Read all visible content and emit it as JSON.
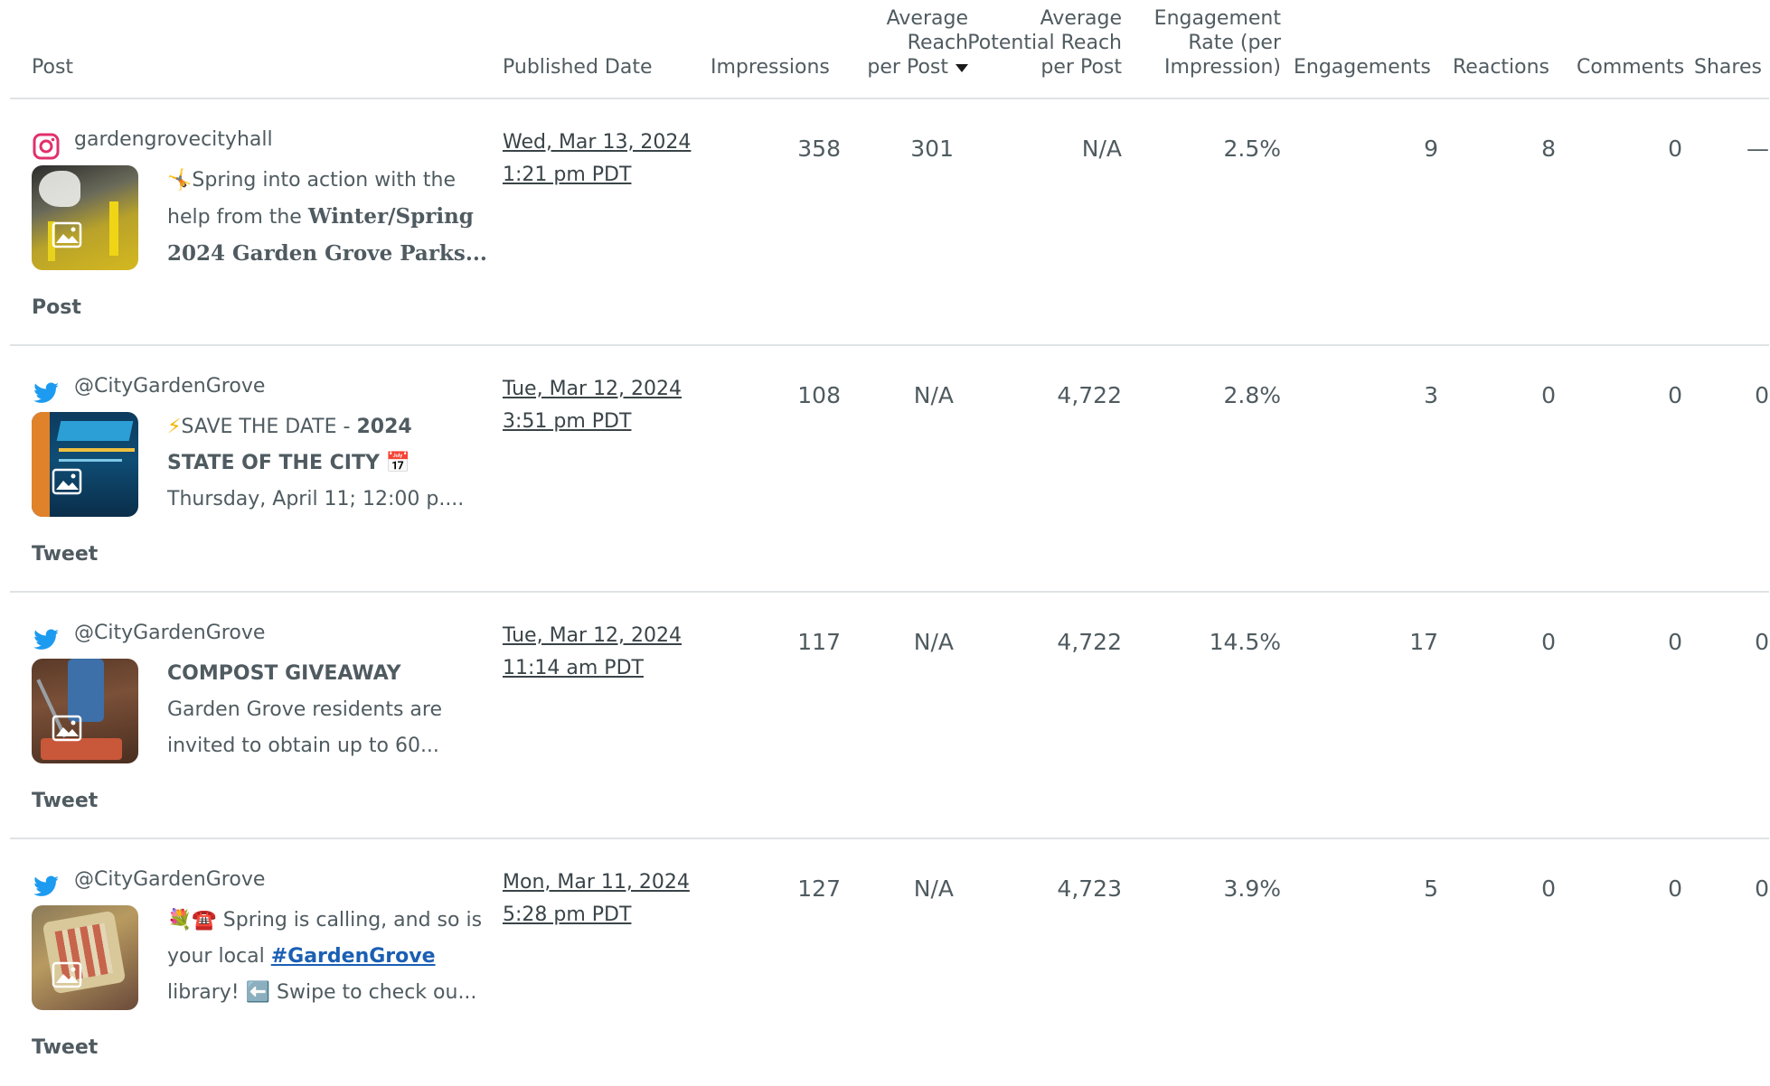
{
  "columns": {
    "post": "Post",
    "published_date": "Published Date",
    "impressions": "Impressions",
    "avg_reach_l1": "Average",
    "avg_reach_l2": "Reach",
    "avg_reach_l3": "per Post",
    "avg_pot_l1": "Average",
    "avg_pot_l2": "Potential Reach",
    "avg_pot_l3": "per Post",
    "eng_rate_l1": "Engagement",
    "eng_rate_l2": "Rate (per",
    "eng_rate_l3": "Impression)",
    "engagements": "Engagements",
    "reactions": "Reactions",
    "comments": "Comments",
    "shares": "Shares"
  },
  "rows": [
    {
      "network": "instagram-icon",
      "handle": "gardengrovecityhall",
      "text": {
        "l1_emoji": "🤸",
        "l1": "Spring into action with the",
        "l2": "help from the ",
        "l2_bold": "Winter/Spring",
        "l3_bold": "2024 Garden Grove Parks..."
      },
      "type": "Post",
      "date": "Wed, Mar 13, 2024",
      "time": "1:21 pm PDT",
      "impressions": "358",
      "avg_reach": "301",
      "avg_potential_reach": "N/A",
      "engagement_rate": "2.5%",
      "engagements": "9",
      "reactions": "8",
      "comments": "0",
      "shares": "—"
    },
    {
      "network": "twitter-icon",
      "handle": "@CityGardenGrove",
      "text": {
        "l1_emoji": "⚡",
        "l1": "SAVE THE DATE - ",
        "l1_bold": "2024",
        "l2_bold": "STATE OF THE CITY",
        "l2_emoji": "📅",
        "l3": "Thursday, April 11; 12:00 p...."
      },
      "type": "Tweet",
      "date": "Tue, Mar 12, 2024",
      "time": "3:51 pm PDT",
      "impressions": "108",
      "avg_reach": "N/A",
      "avg_potential_reach": "4,722",
      "engagement_rate": "2.8%",
      "engagements": "3",
      "reactions": "0",
      "comments": "0",
      "shares": "0"
    },
    {
      "network": "twitter-icon",
      "handle": "@CityGardenGrove",
      "text": {
        "l1_bold": "COMPOST GIVEAWAY",
        "l2": "Garden Grove residents are",
        "l3": "invited to obtain up to 60..."
      },
      "type": "Tweet",
      "date": "Tue, Mar 12, 2024",
      "time": "11:14 am PDT",
      "impressions": "117",
      "avg_reach": "N/A",
      "avg_potential_reach": "4,722",
      "engagement_rate": "14.5%",
      "engagements": "17",
      "reactions": "0",
      "comments": "0",
      "shares": "0"
    },
    {
      "network": "twitter-icon",
      "handle": "@CityGardenGrove",
      "text": {
        "l1_emoji": "💐☎️",
        "l1": " Spring is calling, and so is",
        "l2": "your local ",
        "l2_tag": "#GardenGrove",
        "l3_emoji": "⬅️",
        "l3a": "library! ",
        "l3": " Swipe to check ou..."
      },
      "type": "Tweet",
      "date": "Mon, Mar 11, 2024",
      "time": "5:28 pm PDT",
      "impressions": "127",
      "avg_reach": "N/A",
      "avg_potential_reach": "4,723",
      "engagement_rate": "3.9%",
      "engagements": "5",
      "reactions": "0",
      "comments": "0",
      "shares": "0"
    }
  ],
  "colors": {
    "instagram": "#e1306c",
    "twitter": "#1d9bf0",
    "divider": "#dfe3e5",
    "text": "#4f5b60"
  }
}
